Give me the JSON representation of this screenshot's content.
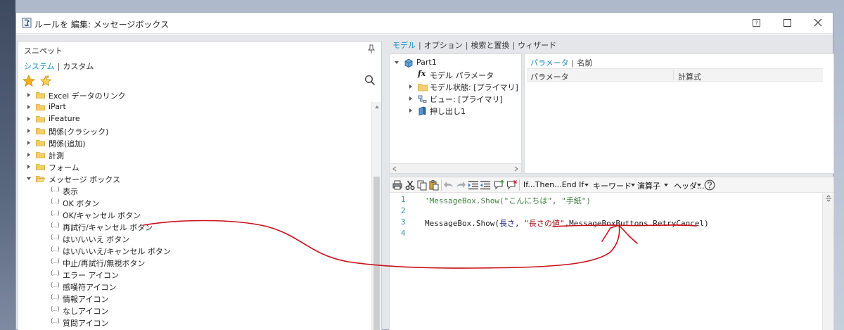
{
  "window": {
    "title": "ルールを 編集: メッセージボックス",
    "help_label": "?"
  },
  "snippets": {
    "title": "スニペット",
    "tabs": {
      "system": "システム",
      "custom": "カスタム",
      "separator": "|"
    },
    "folders": [
      "Excel データのリンク",
      "iPart",
      "iFeature",
      "関係(クラシック)",
      "関係(追加)",
      "計測",
      "フォーム",
      "メッセージ ボックス"
    ],
    "leaf_icon": "(..)",
    "items": [
      "表示",
      "OK ボタン",
      "OK/キャンセル ボタン",
      "再試行/キャンセル ボタン",
      "はい/いいえ ボタン",
      "はい/いいえ/キャンセル ボタン",
      "中止/再試行/無視ボタン",
      "エラー アイコン",
      "感嘆符アイコン",
      "情報アイコン",
      "なしアイコン",
      "質問アイコン"
    ]
  },
  "right_tabs": [
    "モデル",
    "オプション",
    "検索と置換",
    "ウィザード"
  ],
  "model_tree": {
    "root": "Part1",
    "items": [
      "モデル パラメータ",
      "モデル状態: [プライマリ]",
      "ビュー: [プライマリ]",
      "押し出し1"
    ]
  },
  "parameters": {
    "tabs": [
      "パラメータ",
      "名前"
    ],
    "columns": [
      "パラメータ",
      "計算式"
    ]
  },
  "toolbar": {
    "if_then": "If...Then...End If",
    "keyword": "キーワード",
    "operators": "演算子",
    "header": "ヘッダ..."
  },
  "code": {
    "lines": [
      {
        "num": "1",
        "text": "'MessageBox.Show(\"こんにちは\", \"手紙\")"
      },
      {
        "num": "2",
        "text": ""
      },
      {
        "num": "3",
        "p1": "MessageBox.Show(",
        "p2": "長さ",
        "p3": ", ",
        "p4": "\"長さの値\"",
        "p5": ",MessageBoxButtons.RetryCancel)"
      },
      {
        "num": "4",
        "text": ""
      }
    ]
  },
  "colors": {
    "accent": "#1a8fc9",
    "annotation": "#c8101a",
    "comment": "#3f7f3f",
    "string": "#a31515",
    "line_number": "#2b91af"
  }
}
